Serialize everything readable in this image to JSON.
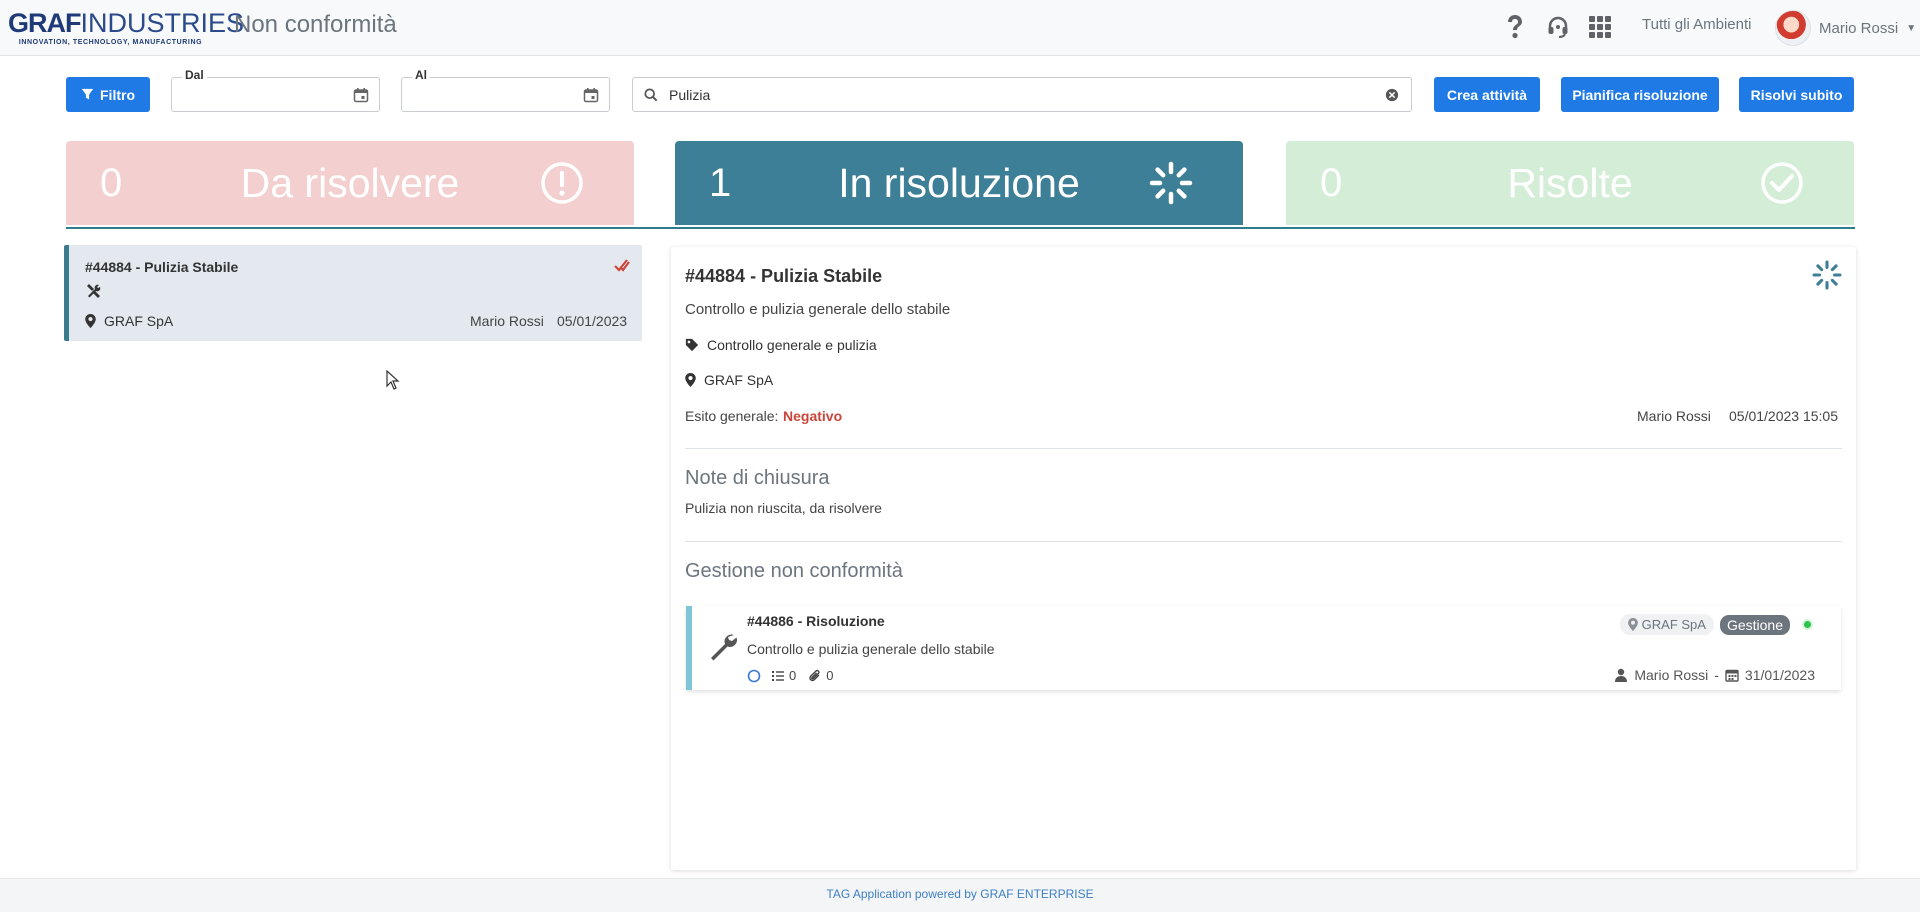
{
  "header": {
    "logo_brand": "GRAF",
    "logo_brand_rest": "INDUSTRIES",
    "logo_tagline": "INNOVATION, TECHNOLOGY, MANUFACTURING",
    "page_title": "Non conformità",
    "environment": "Tutti gli Ambienti",
    "user_name": "Mario Rossi",
    "icons": [
      "help-icon",
      "headset-icon",
      "apps-grid-icon"
    ]
  },
  "toolbar": {
    "filter_label": "Filtro",
    "date_from_label": "Dal",
    "date_to_label": "Al",
    "date_from_value": "",
    "date_to_value": "",
    "search_value": "Pulizia",
    "create_label": "Crea attività",
    "plan_label": "Pianifica risoluzione",
    "resolve_label": "Risolvi subito"
  },
  "stats": [
    {
      "count": "0",
      "label": "Da risolvere",
      "color": "#f3cfcf",
      "icon": "exclamation-circle-icon"
    },
    {
      "count": "1",
      "label": "In risoluzione",
      "color": "#3d7f96",
      "icon": "spinner-icon"
    },
    {
      "count": "0",
      "label": "Risolte",
      "color": "#d4edd7",
      "icon": "check-circle-icon"
    }
  ],
  "list": {
    "items": [
      {
        "title": "#44884 - Pulizia Stabile",
        "location": "GRAF SpA",
        "user": "Mario Rossi",
        "date": "05/01/2023"
      }
    ]
  },
  "detail": {
    "title": "#44884 - Pulizia Stabile",
    "description": "Controllo e pulizia generale dello stabile",
    "category": "Controllo generale e pulizia",
    "location": "GRAF SpA",
    "esito_label": "Esito generale:",
    "esito_value": "Negativo",
    "user": "Mario Rossi",
    "datetime": "05/01/2023 15:05",
    "notes_title": "Note di chiusura",
    "notes_text": "Pulizia non riuscita, da risolvere",
    "management_title": "Gestione non conformità",
    "activity": {
      "title": "#44886 - Risoluzione",
      "description": "Controllo e pulizia generale dello stabile",
      "checklist_count": "0",
      "attachments_count": "0",
      "location_badge": "GRAF SpA",
      "type_badge": "Gestione",
      "user": "Mario Rossi",
      "separator": "-",
      "date": "31/01/2023"
    }
  },
  "footer": {
    "text": "TAG Application powered by GRAF ENTERPRISE"
  }
}
